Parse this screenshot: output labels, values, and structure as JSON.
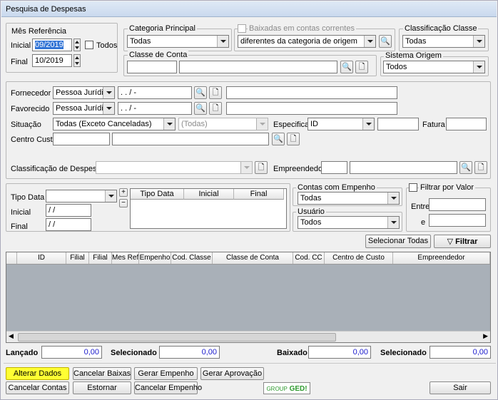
{
  "window": {
    "title": "Pesquisa de Despesas"
  },
  "mes_referencia": {
    "legend": "Mês Referência",
    "inicial_label": "Inicial",
    "inicial_value": "09/2019",
    "final_label": "Final",
    "final_value": "10/2019",
    "todos_label": "Todos"
  },
  "categoria_principal": {
    "legend": "Categoria Principal",
    "value": "Todas"
  },
  "baixadas": {
    "legend": "Baixadas em contas correntes",
    "value": "diferentes da categoria de origem"
  },
  "classificacao_classe": {
    "legend": "Classificação Classe",
    "value": "Todas"
  },
  "classe_conta": {
    "legend": "Classe de Conta"
  },
  "sistema_origem": {
    "legend": "Sistema Origem",
    "value": "Todos"
  },
  "fornecedor": {
    "label": "Fornecedor",
    "tipo": "Pessoa Jurídica",
    "doc": " .   .   /   -"
  },
  "favorecido": {
    "label": "Favorecido",
    "tipo": "Pessoa Jurídica",
    "doc": " .   .   /   -"
  },
  "situacao": {
    "label": "Situação",
    "value": "Todas (Exceto Canceladas)",
    "sub_value": "(Todas)"
  },
  "especificar": {
    "label": "Especificar",
    "value": "ID"
  },
  "fatura": {
    "label": "Fatura"
  },
  "centro_custo": {
    "label": "Centro Custo"
  },
  "classificacao_despesas": {
    "label": "Classificação de Despesas"
  },
  "empreendedor": {
    "label": "Empreendedor"
  },
  "tipo_data": {
    "label": "Tipo Data",
    "inicial_label": "Inicial",
    "inicial_value": " / /",
    "final_label": "Final",
    "final_value": " / /",
    "plus": "+",
    "minus": "−",
    "columns": [
      "Tipo Data",
      "Inicial",
      "Final"
    ]
  },
  "contas_empenho": {
    "legend": "Contas com Empenho",
    "value": "Todas"
  },
  "usuario": {
    "legend": "Usuário",
    "value": "Todos"
  },
  "filtrar_valor": {
    "legend": "Filtrar por Valor",
    "entre_label": "Entre",
    "e_label": "e"
  },
  "actions": {
    "selecionar_todas": "Selecionar Todas",
    "filtrar": "Filtrar"
  },
  "grid": {
    "columns": [
      "",
      "ID",
      "Filial",
      "Filial",
      "Mes Ref.",
      "Empenho",
      "Cod. Classe",
      "Classe de Conta",
      "Cod. CC",
      "Centro de Custo",
      "Empreendedor"
    ]
  },
  "totals": {
    "lancado_label": "Lançado",
    "lancado_value": "0,00",
    "selecionado_label": "Selecionado",
    "selecionado_value": "0,00",
    "baixado_label": "Baixado",
    "baixado_value": "0,00",
    "selecionado2_label": "Selecionado",
    "selecionado2_value": "0,00"
  },
  "buttons": {
    "alterar_dados": "Alterar Dados",
    "cancelar_baixas": "Cancelar Baixas",
    "gerar_empenho": "Gerar Empenho",
    "gerar_aprovacao": "Gerar Aprovação",
    "cancelar_contas": "Cancelar Contas",
    "estornar": "Estornar",
    "cancelar_empenho": "Cancelar Empenho",
    "sair": "Sair"
  },
  "logo": {
    "text_a": "GROUP",
    "text_b": "GED!"
  },
  "colors": {
    "accent": "#ffff33",
    "number": "#1a1acc",
    "logo_green": "#2e9a2e"
  }
}
